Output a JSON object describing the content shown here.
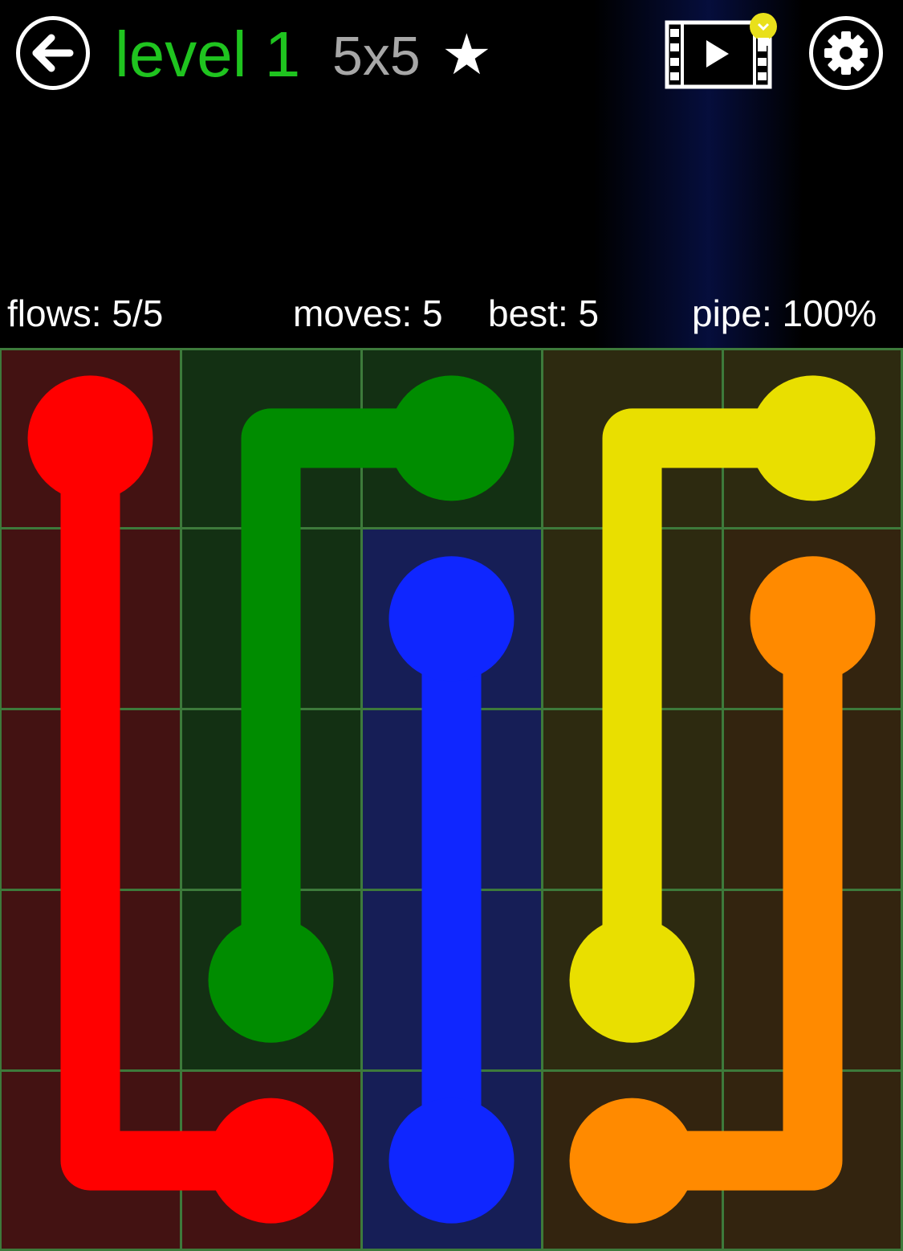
{
  "header": {
    "level_label": "level 1",
    "size_label": "5x5",
    "star_glyph": "★",
    "back_icon": "back-arrow-icon",
    "video_hint_icon": "video-hint-icon",
    "settings_icon": "gear-icon"
  },
  "stats": {
    "flows": "flows: 5/5",
    "moves": "moves: 5",
    "best": "best: 5",
    "pipe": "pipe: 100%"
  },
  "board": {
    "rows": 5,
    "cols": 5,
    "grid_color": "#3d7a3b",
    "colors": {
      "red": "#ff0000",
      "green": "#008c00",
      "blue": "#0f26ff",
      "yellow": "#e9df00",
      "orange": "#ff8a00"
    },
    "tints": {
      "red": "#431212",
      "green": "#133013",
      "blue": "#161e56",
      "yellow": "#2d2a10",
      "orange": "#33240f"
    },
    "cells": [
      [
        "red",
        "green",
        "green",
        "yellow",
        "yellow"
      ],
      [
        "red",
        "green",
        "blue",
        "yellow",
        "orange"
      ],
      [
        "red",
        "green",
        "blue",
        "yellow",
        "orange"
      ],
      [
        "red",
        "green",
        "blue",
        "yellow",
        "orange"
      ],
      [
        "red",
        "red",
        "blue",
        "orange",
        "orange"
      ]
    ],
    "flows": [
      {
        "color": "red",
        "path": [
          [
            0,
            0
          ],
          [
            1,
            0
          ],
          [
            2,
            0
          ],
          [
            3,
            0
          ],
          [
            4,
            0
          ],
          [
            4,
            1
          ]
        ]
      },
      {
        "color": "green",
        "path": [
          [
            0,
            2
          ],
          [
            0,
            1
          ],
          [
            1,
            1
          ],
          [
            2,
            1
          ],
          [
            3,
            1
          ]
        ]
      },
      {
        "color": "blue",
        "path": [
          [
            1,
            2
          ],
          [
            2,
            2
          ],
          [
            3,
            2
          ],
          [
            4,
            2
          ]
        ]
      },
      {
        "color": "yellow",
        "path": [
          [
            0,
            4
          ],
          [
            0,
            3
          ],
          [
            1,
            3
          ],
          [
            2,
            3
          ],
          [
            3,
            3
          ]
        ]
      },
      {
        "color": "orange",
        "path": [
          [
            1,
            4
          ],
          [
            2,
            4
          ],
          [
            3,
            4
          ],
          [
            4,
            4
          ],
          [
            4,
            3
          ]
        ]
      }
    ]
  }
}
